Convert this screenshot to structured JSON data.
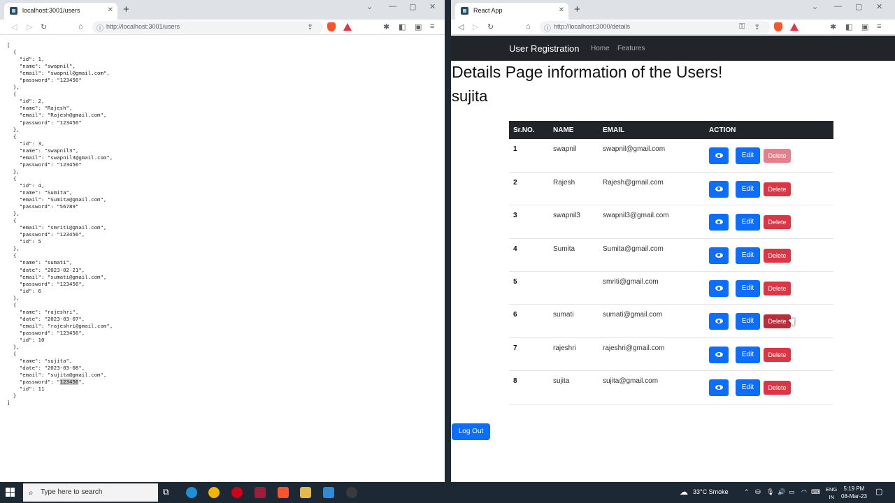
{
  "left_browser": {
    "tab_title": "localhost:3001/users",
    "url": "http://localhost:3001/users",
    "json_text": "[\n  {\n    \"id\": 1,\n    \"name\": \"swapnil\",\n    \"email\": \"swapnil@gmail.com\",\n    \"password\": \"123456\"\n  },\n  {\n    \"id\": 2,\n    \"name\": \"Rajesh\",\n    \"email\": \"Rajesh@gmail.com\",\n    \"password\": \"123456\"\n  },\n  {\n    \"id\": 3,\n    \"name\": \"swapnil3\",\n    \"email\": \"swapnil3@gmail.com\",\n    \"password\": \"123456\"\n  },\n  {\n    \"id\": 4,\n    \"name\": \"Sumita\",\n    \"email\": \"Sumita@gmail.com\",\n    \"password\": \"56789\"\n  },\n  {\n    \"email\": \"smriti@gmail.com\",\n    \"password\": \"123456\",\n    \"id\": 5\n  },\n  {\n    \"name\": \"sumati\",\n    \"date\": \"2023-02-21\",\n    \"email\": \"sumati@gmail.com\",\n    \"password\": \"123456\",\n    \"id\": 6\n  },\n  {\n    \"name\": \"rajeshri\",\n    \"date\": \"2023-03-07\",\n    \"email\": \"rajeshri@gmail.com\",\n    \"password\": \"123456\",\n    \"id\": 10\n  },\n  {\n    \"name\": \"sujita\",\n    \"date\": \"2023-03-08\",\n    \"email\": \"sujita@gmail.com\",\n    \"password\": \"",
    "json_highlight": "123456",
    "json_tail": "\",\n    \"id\": 11\n  }\n]"
  },
  "right_browser": {
    "tab_title": "React App",
    "url": "http://localhost:3000/details"
  },
  "app": {
    "brand": "User Registration",
    "nav": [
      "Home",
      "Features"
    ],
    "heading": "Details Page information of the Users!",
    "current_user": "sujita",
    "columns": [
      "Sr.NO.",
      "NAME",
      "EMAIL",
      "ACTION"
    ],
    "rows": [
      {
        "no": "1",
        "name": "swapnil",
        "email": "swapnil@gmail.com"
      },
      {
        "no": "2",
        "name": "Rajesh",
        "email": "Rajesh@gmail.com"
      },
      {
        "no": "3",
        "name": "swapnil3",
        "email": "swapnil3@gmail.com"
      },
      {
        "no": "4",
        "name": "Sumita",
        "email": "Sumita@gmail.com"
      },
      {
        "no": "5",
        "name": "",
        "email": "smriti@gmail.com"
      },
      {
        "no": "6",
        "name": "sumati",
        "email": "sumati@gmail.com"
      },
      {
        "no": "7",
        "name": "rajeshri",
        "email": "rajeshri@gmail.com"
      },
      {
        "no": "8",
        "name": "sujita",
        "email": "sujita@gmail.com"
      }
    ],
    "edit_label": "Edit",
    "delete_label": "Delete",
    "logout_label": "Log Out"
  },
  "taskbar": {
    "search_placeholder": "Type here to search",
    "weather": "33°C  Smoke",
    "lang": "ENG",
    "region": "IN",
    "time": "5:19 PM",
    "date": "08-Mar-23"
  },
  "colors": {
    "primary": "#0d6efd",
    "danger": "#dc3545",
    "navbar": "#212529"
  }
}
